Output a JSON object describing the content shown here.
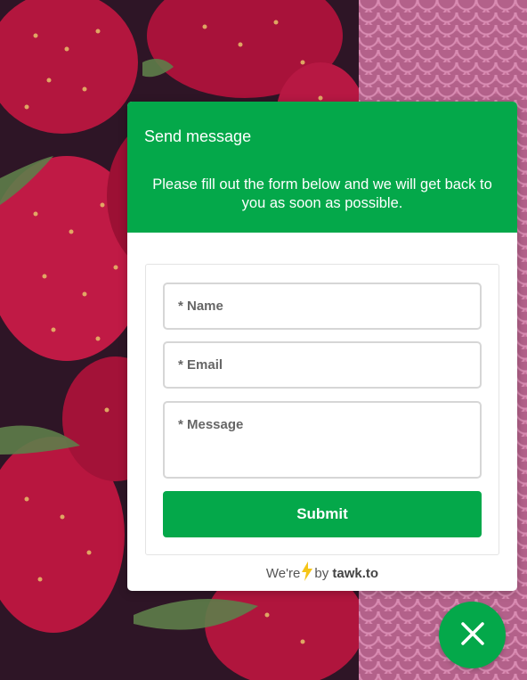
{
  "header": {
    "title": "Send message",
    "description": "Please fill out the form below and we will get back to you as soon as possible."
  },
  "form": {
    "name_placeholder": "* Name",
    "email_placeholder": "* Email",
    "message_placeholder": "* Message",
    "submit_label": "Submit"
  },
  "branding": {
    "prefix": "We're",
    "by": "by",
    "brand": "tawk.to",
    "icon": "lightning-bolt-icon"
  },
  "close_button": {
    "icon": "close-icon"
  },
  "colors": {
    "accent": "#04a84a",
    "bolt": "#f5c518",
    "pattern": "#c56f98"
  }
}
